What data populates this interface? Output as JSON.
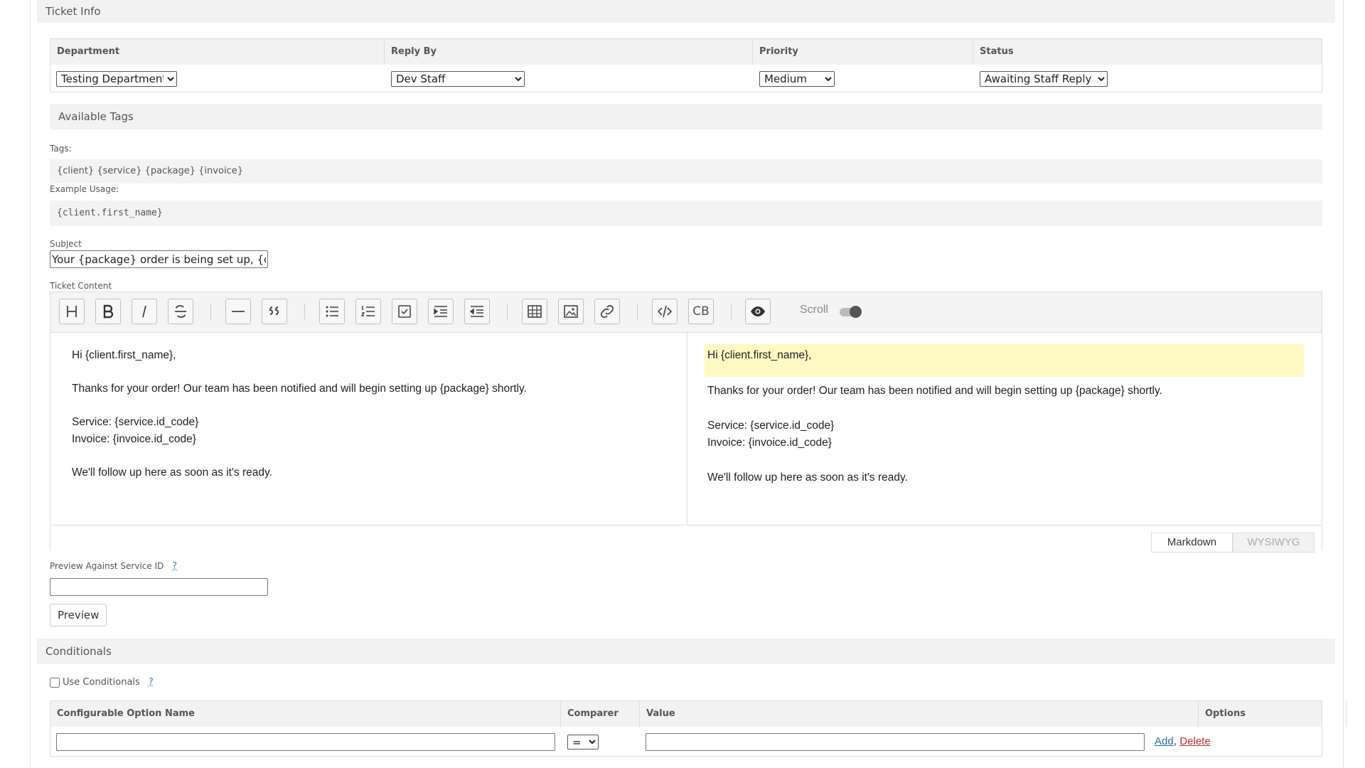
{
  "ticket_info": {
    "section_title": "Ticket Info",
    "columns": {
      "department": "Department",
      "reply_by": "Reply By",
      "priority": "Priority",
      "status": "Status"
    },
    "department_value": "Testing Department",
    "reply_by_value": "Dev Staff",
    "priority_value": "Medium",
    "status_value": "Awaiting Staff Reply"
  },
  "tags": {
    "section_title": "Available Tags",
    "tags_label": "Tags:",
    "tags_value": "{client} {service} {package} {invoice}",
    "example_label": "Example Usage:",
    "example_value": "{client.first_name}"
  },
  "subject": {
    "label": "Subject",
    "value": "Your {package} order is being set up, {client.first_name}"
  },
  "content": {
    "label": "Ticket Content",
    "toolbar": {
      "scroll_label": "Scroll",
      "cb_label": "CB"
    },
    "editor_lines": {
      "greeting": "Hi {client.first_name},",
      "thanks": "Thanks for your order! Our team has been notified and will begin setting up {package} shortly.",
      "service": "Service: {service.id_code}",
      "invoice": "Invoice: {invoice.id_code}",
      "follow_up": "We'll follow up here as soon as it's ready."
    },
    "modes": {
      "markdown": "Markdown",
      "wysiwyg": "WYSIWYG"
    }
  },
  "preview": {
    "label": "Preview Against Service ID",
    "help": "?",
    "input_value": "",
    "button": "Preview"
  },
  "conditionals": {
    "section_title": "Conditionals",
    "use_label": "Use Conditionals",
    "help": "?",
    "columns": {
      "option_name": "Configurable Option Name",
      "comparer": "Comparer",
      "value": "Value",
      "options": "Options"
    },
    "comparer_value": "=",
    "add_link": "Add",
    "separator": ",",
    "delete_link": "Delete"
  },
  "colors": {
    "highlight": "#fff9c4",
    "link_add": "#2b6cb0",
    "link_delete": "#c53030"
  }
}
